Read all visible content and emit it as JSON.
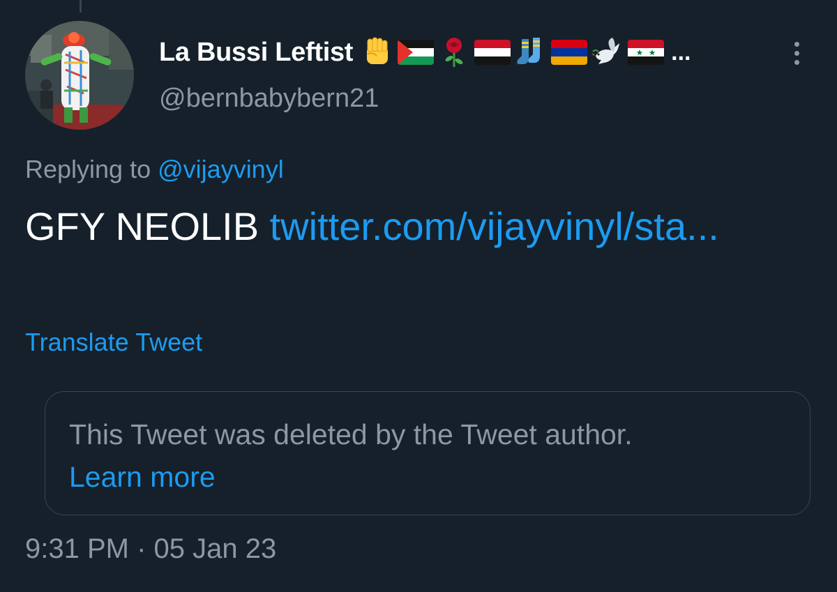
{
  "author": {
    "display_name": "La Bussi Leftist",
    "name_ellipsis": "...",
    "handle": "@bernbabybern21",
    "name_emoji_icons": [
      "raised-fist-icon",
      "palestine-flag-icon",
      "rose-icon",
      "yemen-flag-icon",
      "socks-icon",
      "armenia-flag-icon",
      "dove-icon",
      "syria-flag-icon"
    ]
  },
  "reply": {
    "prefix": "Replying to",
    "mention": "@vijayvinyl"
  },
  "tweet": {
    "text": "GFY NEOLIB",
    "link": "twitter.com/vijayvinyl/sta..."
  },
  "translate_label": "Translate Tweet",
  "quoted": {
    "deleted_message": "This Tweet was deleted by the Tweet author.",
    "learn_more": "Learn more"
  },
  "timestamp": "9:31 PM · 05 Jan 23",
  "colors": {
    "background": "#15202b",
    "accent": "#1d9bf0",
    "secondary_text": "#8b98a5",
    "border": "#38444d"
  }
}
